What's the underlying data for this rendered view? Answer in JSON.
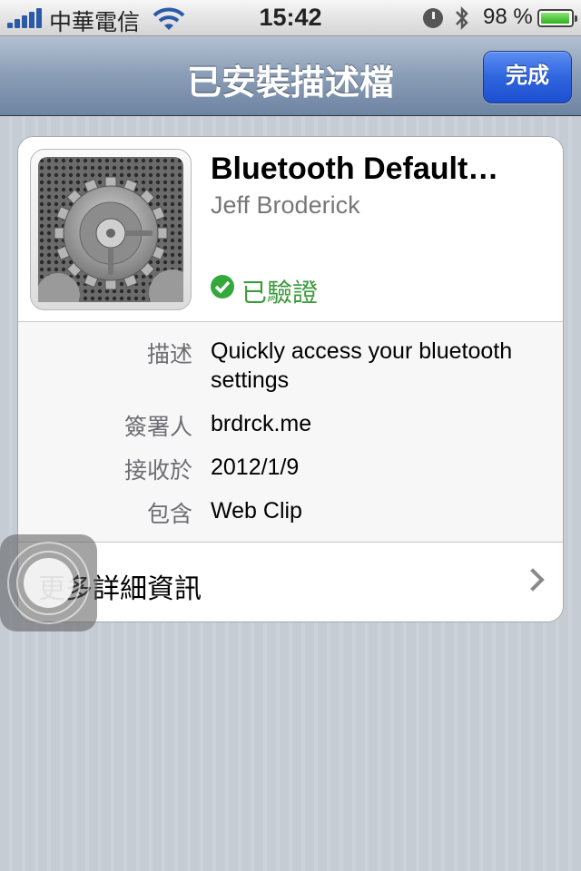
{
  "status_bar": {
    "carrier": "中華電信",
    "time": "15:42",
    "battery_percent": "98 %",
    "battery_level": 0.98,
    "signal_bars": 5,
    "icons": [
      "signal-icon",
      "wifi-icon",
      "alarm-icon",
      "bluetooth-icon",
      "battery-icon"
    ]
  },
  "nav": {
    "title": "已安裝描述檔",
    "done_label": "完成"
  },
  "profile": {
    "name": "Bluetooth Default…",
    "publisher": "Jeff Broderick",
    "verified_label": "已驗證",
    "icon": "settings-gear-icon"
  },
  "details": [
    {
      "label": "描述",
      "value": "Quickly access your bluetooth settings"
    },
    {
      "label": "簽署人",
      "value": "brdrck.me"
    },
    {
      "label": "接收於",
      "value": "2012/1/9"
    },
    {
      "label": "包含",
      "value": "Web Clip"
    }
  ],
  "more": {
    "label": "更多詳細資訊",
    "icon": "chevron-right-icon"
  },
  "colors": {
    "verified": "#3d9a3e",
    "done_button": "#2f65de",
    "nav_bar": "#8a9db6"
  }
}
